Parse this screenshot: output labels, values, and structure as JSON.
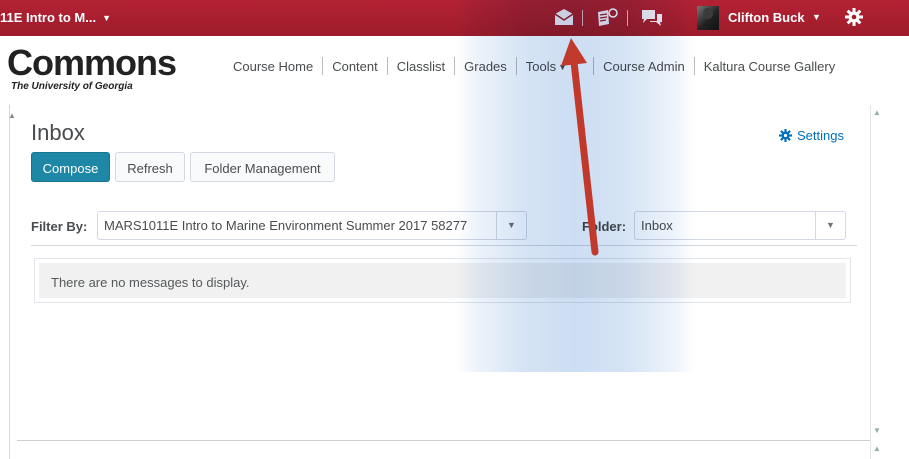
{
  "topbar": {
    "course_selector": "11E Intro to M...",
    "user_name": "Clifton Buck"
  },
  "header": {
    "logo_main": "Commons",
    "logo_sub": "The University of Georgia",
    "nav": [
      "Course Home",
      "Content",
      "Classlist",
      "Grades",
      "Tools",
      "Course Admin",
      "Kaltura Course Gallery"
    ]
  },
  "page": {
    "title": "Inbox",
    "settings_label": "Settings"
  },
  "toolbar": {
    "compose": "Compose",
    "refresh": "Refresh",
    "folder_management": "Folder Management"
  },
  "filters": {
    "filter_label": "Filter By:",
    "filter_value": "MARS1011E Intro to Marine Environment Summer 2017 58277",
    "folder_label": "Folder:",
    "folder_value": "Inbox"
  },
  "messages": {
    "empty_text": "There are no messages to display."
  },
  "colors": {
    "topbar": "#9f1c2b",
    "primary_button": "#1e87a5",
    "link": "#006fbf",
    "annotation_arrow": "#c0392b"
  }
}
